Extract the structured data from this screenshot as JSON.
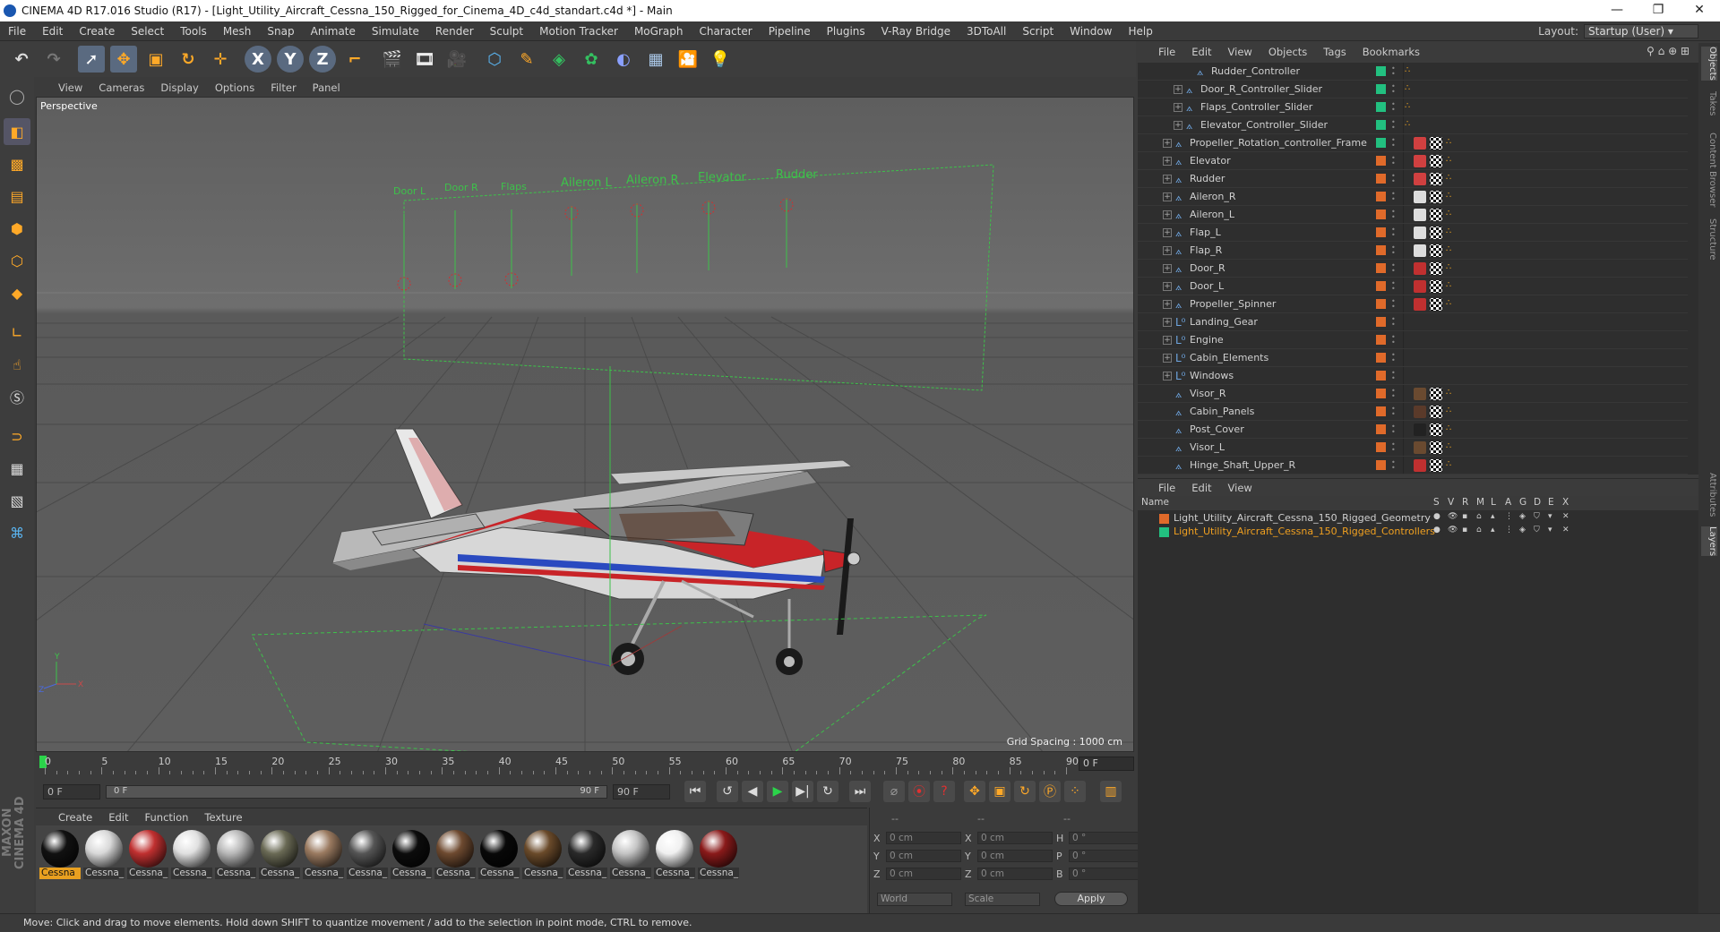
{
  "window": {
    "title": "CINEMA 4D R17.016 Studio (R17) - [Light_Utility_Aircraft_Cessna_150_Rigged_for_Cinema_4D_c4d_standart.c4d *] - Main",
    "min": "—",
    "restore": "❐",
    "close": "✕"
  },
  "menu": [
    "File",
    "Edit",
    "Create",
    "Select",
    "Tools",
    "Mesh",
    "Snap",
    "Animate",
    "Simulate",
    "Render",
    "Sculpt",
    "Motion Tracker",
    "MoGraph",
    "Character",
    "Pipeline",
    "Plugins",
    "V-Ray Bridge",
    "3DToAll",
    "Script",
    "Window",
    "Help"
  ],
  "layout": {
    "label": "Layout:",
    "value": "Startup (User)"
  },
  "viewport": {
    "menu": [
      "View",
      "Cameras",
      "Display",
      "Options",
      "Filter",
      "Panel"
    ],
    "label": "Perspective",
    "grid_spacing": "Grid Spacing : 1000 cm",
    "controllers": [
      "Door L",
      "Door R",
      "Flaps",
      "Aileron L",
      "Aileron R",
      "Elevator",
      "Rudder"
    ]
  },
  "timeline": {
    "ticks": [
      "0",
      "5",
      "10",
      "15",
      "20",
      "25",
      "30",
      "35",
      "40",
      "45",
      "50",
      "55",
      "60",
      "65",
      "70",
      "75",
      "80",
      "85",
      "90"
    ],
    "current": "0 F"
  },
  "transport": {
    "start": "0 F",
    "range_start": "0 F",
    "range_end": "90 F",
    "end": "90 F"
  },
  "materials": {
    "menu": [
      "Create",
      "Edit",
      "Function",
      "Texture"
    ],
    "items": [
      {
        "label": "Cessna",
        "color": "#111111",
        "sel": true
      },
      {
        "label": "Cessna_",
        "color": "#d8d8d8"
      },
      {
        "label": "Cessna_",
        "color": "#c03030"
      },
      {
        "label": "Cessna_",
        "color": "#e0e0e0"
      },
      {
        "label": "Cessna_",
        "color": "#b8b8b8"
      },
      {
        "label": "Cessna_",
        "color": "#6a6a55"
      },
      {
        "label": "Cessna_",
        "color": "#9a7a60"
      },
      {
        "label": "Cessna_",
        "color": "#555555"
      },
      {
        "label": "Cessna_",
        "color": "#0c0c0c"
      },
      {
        "label": "Cessna_",
        "color": "#6e4a30"
      },
      {
        "label": "Cessna_",
        "color": "#080808"
      },
      {
        "label": "Cessna_",
        "color": "#6a4a2a"
      },
      {
        "label": "Cessna_",
        "color": "#2a2a2a"
      },
      {
        "label": "Cessna_",
        "color": "#c4c4c4"
      },
      {
        "label": "Cessna_",
        "color": "#f0f0f0"
      },
      {
        "label": "Cessna_",
        "color": "#8a1a1a"
      }
    ]
  },
  "coords": {
    "header": [
      "--",
      "--",
      "--"
    ],
    "rows": [
      [
        "X",
        "0 cm",
        "X",
        "0 cm",
        "H",
        "0 °"
      ],
      [
        "Y",
        "0 cm",
        "Y",
        "0 cm",
        "P",
        "0 °"
      ],
      [
        "Z",
        "0 cm",
        "Z",
        "0 cm",
        "B",
        "0 °"
      ]
    ],
    "world": "World",
    "scale": "Scale",
    "apply": "Apply"
  },
  "objects": {
    "menu": [
      "File",
      "Edit",
      "View",
      "Objects",
      "Tags",
      "Bookmarks"
    ],
    "rows": [
      {
        "name": "Rudder_Controller",
        "indent": 3,
        "exp": false,
        "icon": "bone",
        "color": "#22c080"
      },
      {
        "name": "Door_R_Controller_Slider",
        "indent": 2,
        "exp": true,
        "icon": "bone",
        "color": "#22c080"
      },
      {
        "name": "Flaps_Controller_Slider",
        "indent": 2,
        "exp": true,
        "icon": "bone",
        "color": "#22c080"
      },
      {
        "name": "Elevator_Controller_Slider",
        "indent": 2,
        "exp": true,
        "icon": "bone",
        "color": "#22c080"
      },
      {
        "name": "Propeller_Rotation_controller_Frame",
        "indent": 1,
        "exp": true,
        "icon": "bone",
        "color": "#22c080"
      },
      {
        "name": "Elevator",
        "indent": 1,
        "exp": true,
        "icon": "bone",
        "color": "#e06a2a"
      },
      {
        "name": "Rudder",
        "indent": 1,
        "exp": true,
        "icon": "bone",
        "color": "#e06a2a"
      },
      {
        "name": "Aileron_R",
        "indent": 1,
        "exp": true,
        "icon": "bone",
        "color": "#e06a2a"
      },
      {
        "name": "Aileron_L",
        "indent": 1,
        "exp": true,
        "icon": "bone",
        "color": "#e06a2a"
      },
      {
        "name": "Flap_L",
        "indent": 1,
        "exp": true,
        "icon": "bone",
        "color": "#e06a2a"
      },
      {
        "name": "Flap_R",
        "indent": 1,
        "exp": true,
        "icon": "bone",
        "color": "#e06a2a"
      },
      {
        "name": "Door_R",
        "indent": 1,
        "exp": true,
        "icon": "bone",
        "color": "#e06a2a"
      },
      {
        "name": "Door_L",
        "indent": 1,
        "exp": true,
        "icon": "bone",
        "color": "#e06a2a"
      },
      {
        "name": "Propeller_Spinner",
        "indent": 1,
        "exp": true,
        "icon": "bone",
        "color": "#e06a2a"
      },
      {
        "name": "Landing_Gear",
        "indent": 1,
        "exp": true,
        "icon": "null",
        "color": "#e06a2a"
      },
      {
        "name": "Engine",
        "indent": 1,
        "exp": true,
        "icon": "null",
        "color": "#e06a2a"
      },
      {
        "name": "Cabin_Elements",
        "indent": 1,
        "exp": true,
        "icon": "null",
        "color": "#e06a2a"
      },
      {
        "name": "Windows",
        "indent": 1,
        "exp": true,
        "icon": "null",
        "color": "#e06a2a"
      },
      {
        "name": "Visor_R",
        "indent": 1,
        "exp": false,
        "icon": "bone",
        "color": "#e06a2a"
      },
      {
        "name": "Cabin_Panels",
        "indent": 1,
        "exp": false,
        "icon": "bone",
        "color": "#e06a2a"
      },
      {
        "name": "Post_Cover",
        "indent": 1,
        "exp": false,
        "icon": "bone",
        "color": "#e06a2a"
      },
      {
        "name": "Visor_L",
        "indent": 1,
        "exp": false,
        "icon": "bone",
        "color": "#e06a2a"
      },
      {
        "name": "Hinge_Shaft_Upper_R",
        "indent": 1,
        "exp": false,
        "icon": "bone",
        "color": "#e06a2a"
      }
    ]
  },
  "layers": {
    "menu": [
      "File",
      "Edit",
      "View"
    ],
    "header": {
      "name": "Name",
      "cols": [
        "S",
        "V",
        "R",
        "M",
        "L",
        "A",
        "G",
        "D",
        "E",
        "X"
      ]
    },
    "rows": [
      {
        "name": "Light_Utility_Aircraft_Cessna_150_Rigged_Geometry",
        "color": "#e06a2a",
        "text": "#d0d0d0"
      },
      {
        "name": "Light_Utility_Aircraft_Cessna_150_Rigged_Controllers",
        "color": "#22c080",
        "text": "#f0a020"
      }
    ]
  },
  "sidetabs": [
    "Objects",
    "Takes",
    "Content Browser",
    "Structure",
    "Attributes",
    "Layers"
  ],
  "status": "Move: Click and drag to move elements. Hold down SHIFT to quantize movement / add to the selection in point mode, CTRL to remove."
}
